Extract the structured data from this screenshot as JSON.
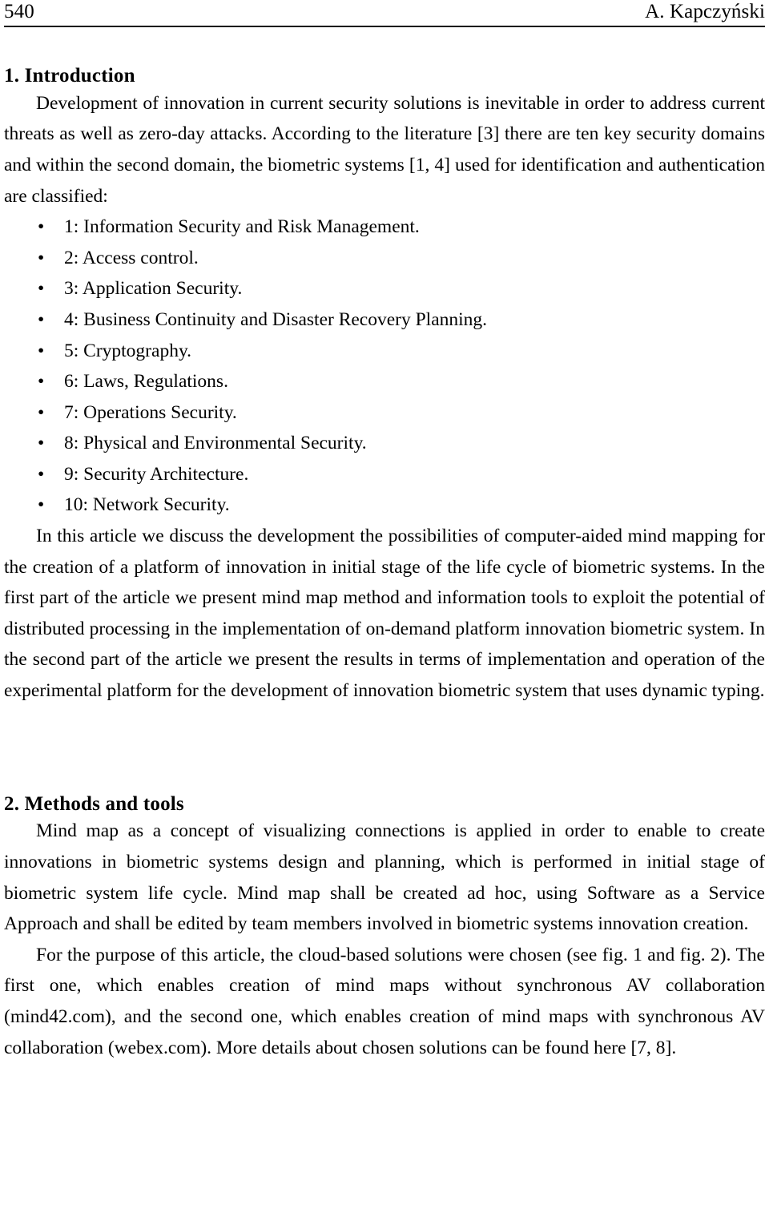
{
  "running_head": {
    "page_number": "540",
    "author": "A. Kapczyński"
  },
  "sections": [
    {
      "heading": "1. Introduction",
      "intro_paragraph": "Development of innovation in current security solutions is inevitable in order to address current threats as well as zero-day attacks. According to the literature [3] there are ten key security domains and within the second domain, the biometric systems [1, 4] used for identification and authentication are classified:",
      "list_bullet_glyph": "•",
      "list_items": [
        "1: Information Security and Risk Management.",
        "2: Access control.",
        "3: Application Security.",
        "4: Business Continuity and Disaster Recovery Planning.",
        "5: Cryptography.",
        "6: Laws, Regulations.",
        "7: Operations Security.",
        "8: Physical and Environmental Security.",
        "9: Security Architecture.",
        "10: Network Security."
      ],
      "closing_paragraph": "In this article we discuss the development the possibilities of computer-aided mind mapping for the creation of a platform of innovation in initial stage of the life cycle of biometric systems. In the first part of the article we present mind map method and information tools to exploit the potential of distributed processing in the implementation of on-demand platform innovation biometric system. In the second part of the article we present the results in terms of implementation and operation of the experimental platform for the development of innovation biometric system that uses dynamic typing."
    },
    {
      "heading": "2. Methods and tools",
      "paragraph_1": "Mind map as a concept of visualizing connections is applied in order to enable to create innovations in biometric systems design and planning, which is performed in initial stage of biometric system life cycle. Mind map shall be created ad hoc, using Software as a Service Approach and shall be edited by team members involved in biometric systems innovation creation.",
      "paragraph_2": "For the purpose of this article, the cloud-based solutions were chosen (see fig. 1 and fig. 2). The first one, which enables creation of mind maps without synchronous AV collaboration (mind42.com), and the second one, which enables creation of mind maps with synchronous AV collaboration (webex.com). More details about chosen solutions can be found here [7, 8]."
    }
  ]
}
